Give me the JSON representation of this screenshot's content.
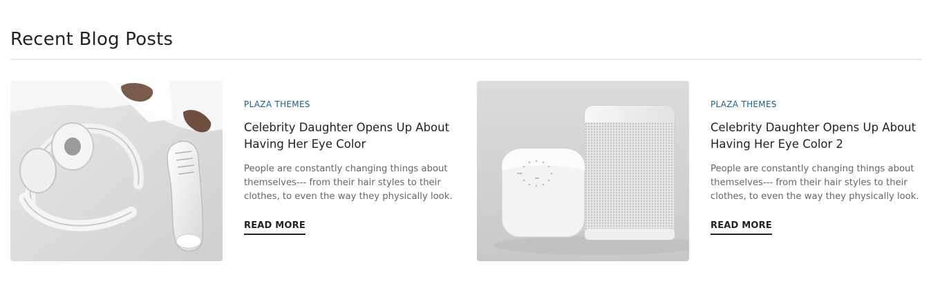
{
  "section": {
    "title": "Recent Blog Posts"
  },
  "posts": [
    {
      "category": "PLAZA THEMES",
      "title": "Celebrity Daughter Opens Up About Having Her Eye Color",
      "excerpt": "People are constantly changing things about themselves--- from their hair styles to their clothes, to even the way they physically look.",
      "read_more": "READ MORE",
      "image_subject": "white headphones and white shoes"
    },
    {
      "category": "PLAZA THEMES",
      "title": "Celebrity Daughter Opens Up About Having Her Eye Color 2",
      "excerpt": "People are constantly changing things about themselves--- from their hair styles to their clothes, to even the way they physically look.",
      "read_more": "READ MORE",
      "image_subject": "white smart speakers"
    }
  ],
  "colors": {
    "category": "#1b5c8e",
    "heading": "#222222",
    "excerpt": "#666666",
    "rule": "#ebebeb"
  }
}
